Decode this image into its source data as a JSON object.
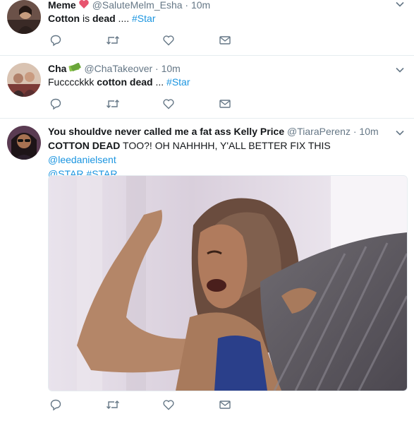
{
  "tweets": [
    {
      "name": "Meme",
      "handle": "@SaluteMelm_Esha",
      "separator": "·",
      "time": "10m",
      "text": {
        "part1": "Cotton",
        "part2": " is ",
        "part3": "dead",
        "part4": " .... ",
        "hashtag": "#Star"
      },
      "emoji": "heart-emoji"
    },
    {
      "name": "Cha",
      "handle": "@ChaTakeover",
      "separator": "·",
      "time": "10m",
      "text": {
        "part1": "Fucccckkk ",
        "part2": "cotton dead",
        "part3": " ... ",
        "hashtag": "#Star"
      },
      "emoji": "money-emoji"
    },
    {
      "name": "You shouldve never called me a fat ass Kelly Price",
      "handle": "@TiaraPerenz",
      "separator": "·",
      "time": "10m",
      "text": {
        "part1": "COTTON DEAD",
        "part2": " TOO?! OH NAHHHH, Y'ALL BETTER FIX THIS ",
        "mention1": "@leedanielsent",
        "mention2": "@STAR",
        "hashtag": "#STAR"
      },
      "media": "gif-woman-shouting"
    }
  ],
  "icons": {
    "reply": "reply-icon",
    "retweet": "retweet-icon",
    "like": "like-icon",
    "dm": "message-icon",
    "caret": "chevron-down-icon"
  },
  "colors": {
    "link": "#1b95e0",
    "secondary": "#657786",
    "icon": "#657786",
    "border": "#e6ecf0"
  }
}
